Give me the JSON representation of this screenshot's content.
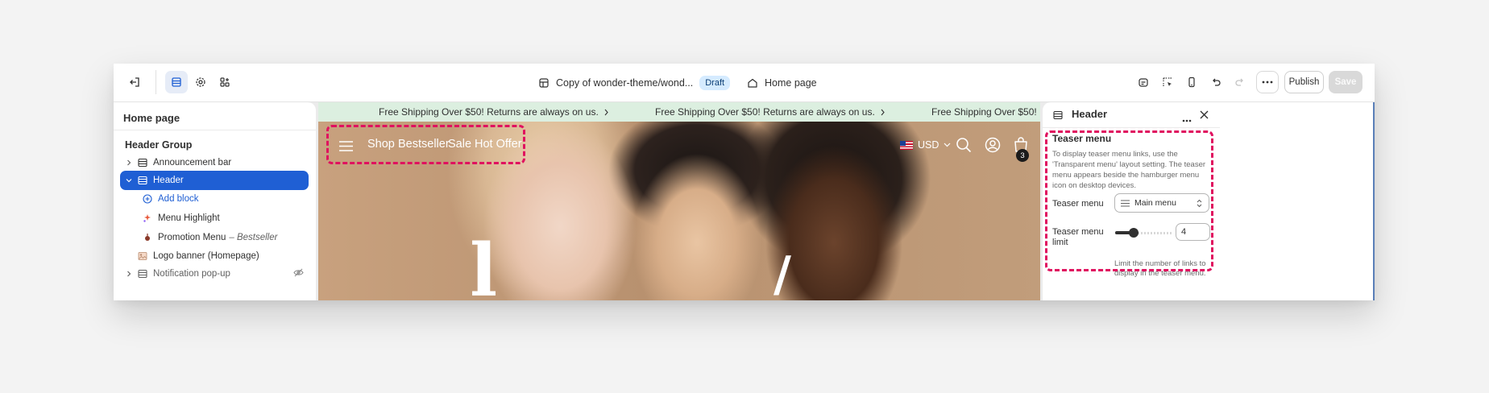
{
  "topbar": {
    "theme_name": "Copy of wonder-theme/wond...",
    "status_badge": "Draft",
    "page_selector": "Home page",
    "publish_label": "Publish",
    "save_label": "Save"
  },
  "sidebar": {
    "title": "Home page",
    "group_title": "Header Group",
    "items": [
      {
        "label": "Announcement bar",
        "icon": "section-icon",
        "expandable": true
      },
      {
        "label": "Header",
        "icon": "section-icon",
        "expandable": true,
        "selected": true
      },
      {
        "label": "Add block",
        "icon": "plus-circle-icon"
      },
      {
        "label": "Menu Highlight",
        "icon": "sparkle-icon"
      },
      {
        "label": "Promotion Menu",
        "suffix": "– Bestseller",
        "icon": "pin-icon"
      },
      {
        "label": "Logo banner (Homepage)",
        "icon": "image-icon"
      },
      {
        "label": "Notification pop-up",
        "icon": "section-icon",
        "expandable": true,
        "hidden": true
      }
    ]
  },
  "preview": {
    "announcement": "Free Shipping Over $50! Returns are always on us.",
    "nav_links": [
      "Shop",
      "Bestseller",
      "Sale",
      "Hot Offer"
    ],
    "currency": "USD",
    "cart_count": "3"
  },
  "settings": {
    "title": "Header",
    "section_title": "Teaser menu",
    "description": "To display teaser menu links, use the 'Transparent menu' layout setting. The teaser menu appears beside the hamburger menu icon on desktop devices.",
    "menu_label": "Teaser menu",
    "menu_value": "Main menu",
    "limit_label": "Teaser menu limit",
    "limit_value": "4",
    "limit_hint": "Limit the number of links to display in the teaser menu."
  },
  "colors": {
    "accent": "#1f5fd4",
    "highlight_dash": "#e0115f",
    "announcement_bg": "#dcefe0"
  }
}
